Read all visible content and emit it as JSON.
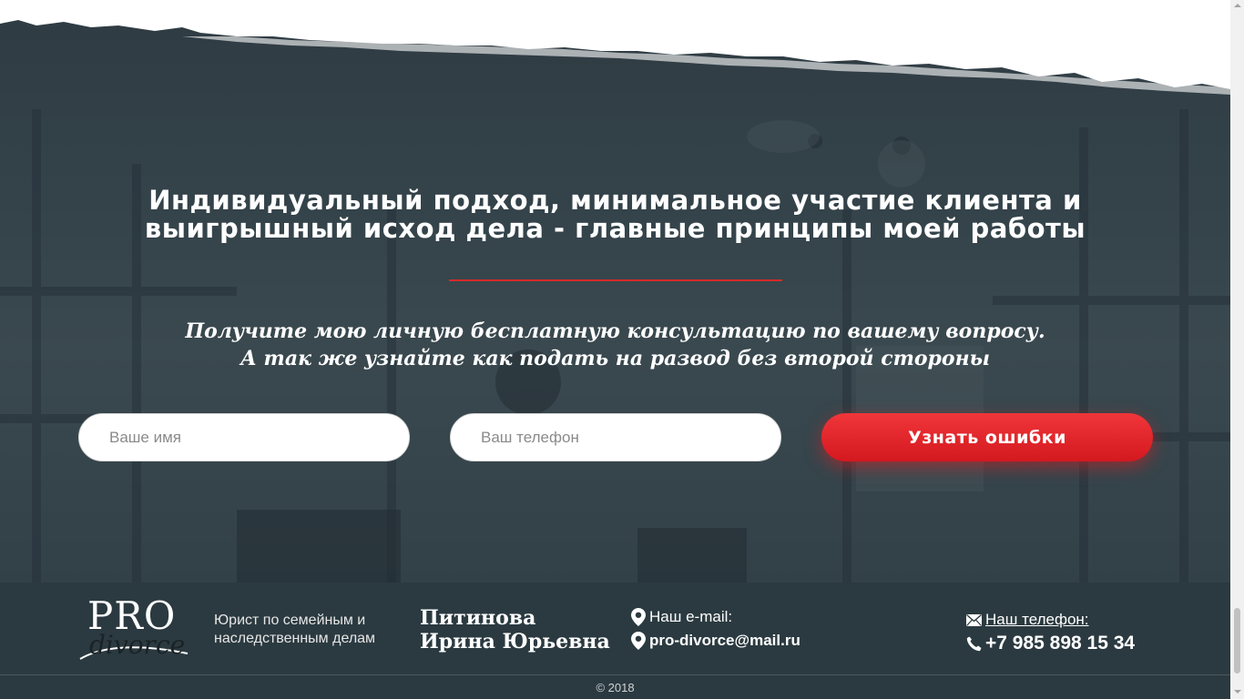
{
  "hero": {
    "title_line1": "Индивидуальный подход, минимальное участие клиента и",
    "title_line2": "выигрышный исход дела - главные принципы моей работы",
    "subtitle_line1": "Получите мою личную бесплатную консультацию по вашему вопросу.",
    "subtitle_line2": "А так же узнайте как подать на развод без второй стороны",
    "accent_color": "#d42a2a"
  },
  "form": {
    "name_placeholder": "Ваше имя",
    "phone_placeholder": "Ваш телефон",
    "submit_label": "Узнать ошибки",
    "button_color": "#e3262b"
  },
  "footer": {
    "logo_pro": "PRO",
    "logo_divorce": "divorce",
    "tagline": "Юрист по семейным и наследственным делам",
    "name_line1": "Питинова",
    "name_line2": "Ирина Юрьевна",
    "email_label": "Наш e-mail:",
    "email_value": "pro-divorce@mail.ru",
    "phone_label": "Наш телефон:",
    "phone_value": "+7 985 898 15 34",
    "copyright": "© 2018",
    "background_color": "#2b3a40"
  }
}
